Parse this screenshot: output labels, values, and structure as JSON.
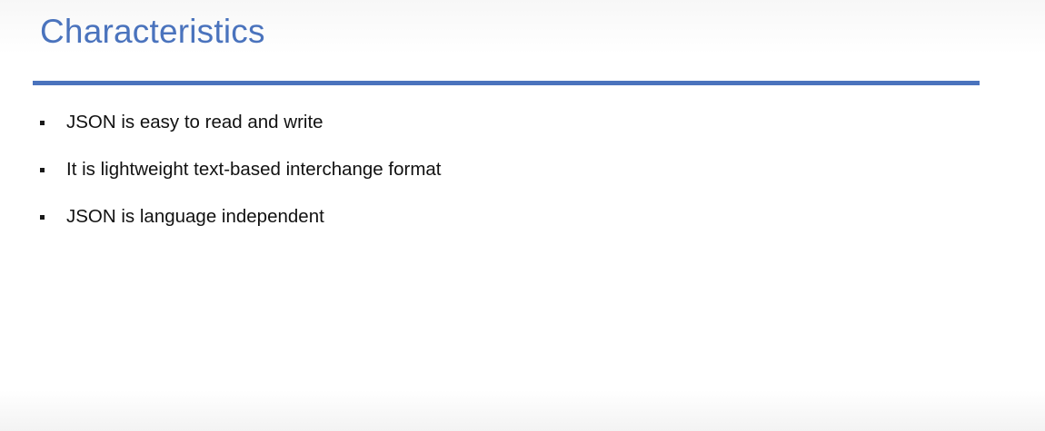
{
  "slide": {
    "title": "Characteristics",
    "accent_color": "#4a73bd",
    "bullets": [
      {
        "text": "JSON is easy to read and write"
      },
      {
        "text": "It is lightweight text-based interchange format"
      },
      {
        "text": "JSON is language independent"
      }
    ]
  }
}
